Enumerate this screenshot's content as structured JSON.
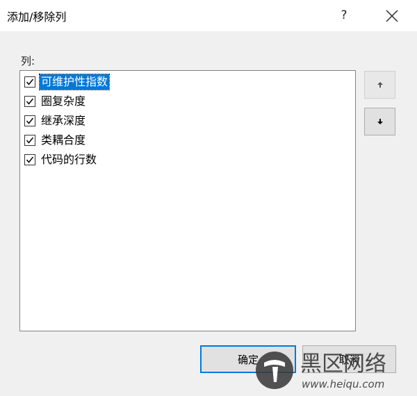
{
  "dialog": {
    "title": "添加/移除列",
    "help_label": "?",
    "columns_label": "列:"
  },
  "columns": [
    {
      "label": "可维护性指数",
      "checked": true,
      "selected": true
    },
    {
      "label": "圈复杂度",
      "checked": true,
      "selected": false
    },
    {
      "label": "继承深度",
      "checked": true,
      "selected": false
    },
    {
      "label": "类耦合度",
      "checked": true,
      "selected": false
    },
    {
      "label": "代码的行数",
      "checked": true,
      "selected": false
    }
  ],
  "buttons": {
    "move_up_icon": "arrow-up-icon",
    "move_down_icon": "arrow-down-icon",
    "ok": "确定",
    "cancel": "取消"
  },
  "watermark": {
    "brand": "黑区网络",
    "url": "www.heiqu.com"
  },
  "colors": {
    "selection": "#0078d7",
    "dialog_bg": "#f0f0f0",
    "titlebar_bg": "#ffffff"
  }
}
